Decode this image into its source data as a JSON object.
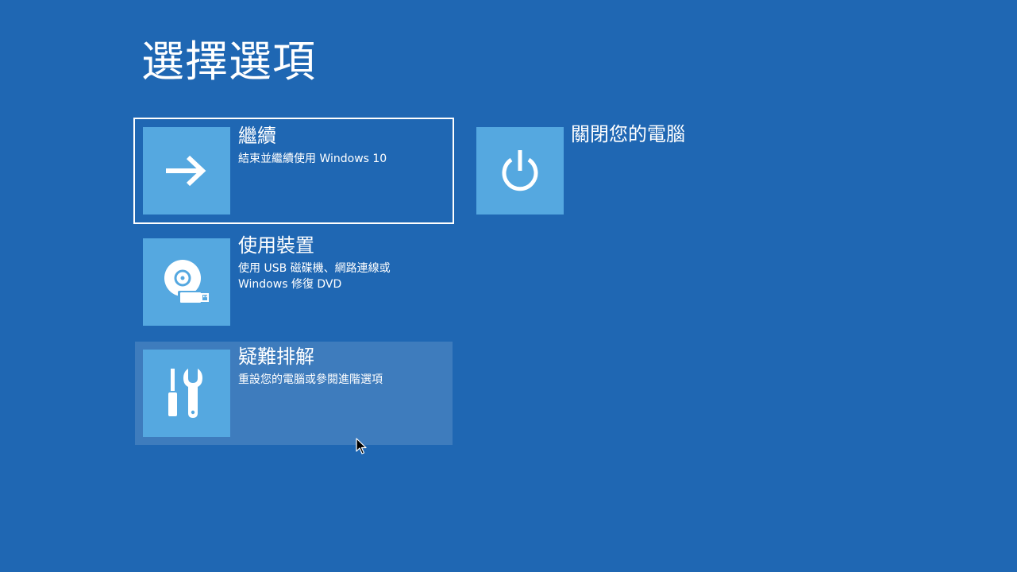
{
  "page": {
    "title": "選擇選項"
  },
  "options": [
    {
      "id": "continue",
      "icon": "arrow-right-icon",
      "title": "繼續",
      "description": "結束並繼續使用 Windows 10"
    },
    {
      "id": "use-device",
      "icon": "disc-usb-icon",
      "title": "使用裝置",
      "description": "使用 USB 磁碟機、網路連線或\nWindows 修復 DVD"
    },
    {
      "id": "troubleshoot",
      "icon": "tools-icon",
      "title": "疑難排解",
      "description": "重設您的電腦或參閱進階選項"
    },
    {
      "id": "turn-off",
      "icon": "power-icon",
      "title": "關閉您的電腦",
      "description": ""
    }
  ],
  "colors": {
    "background": "#1f67b3",
    "tile": "#55a8e0",
    "text": "#ffffff"
  }
}
